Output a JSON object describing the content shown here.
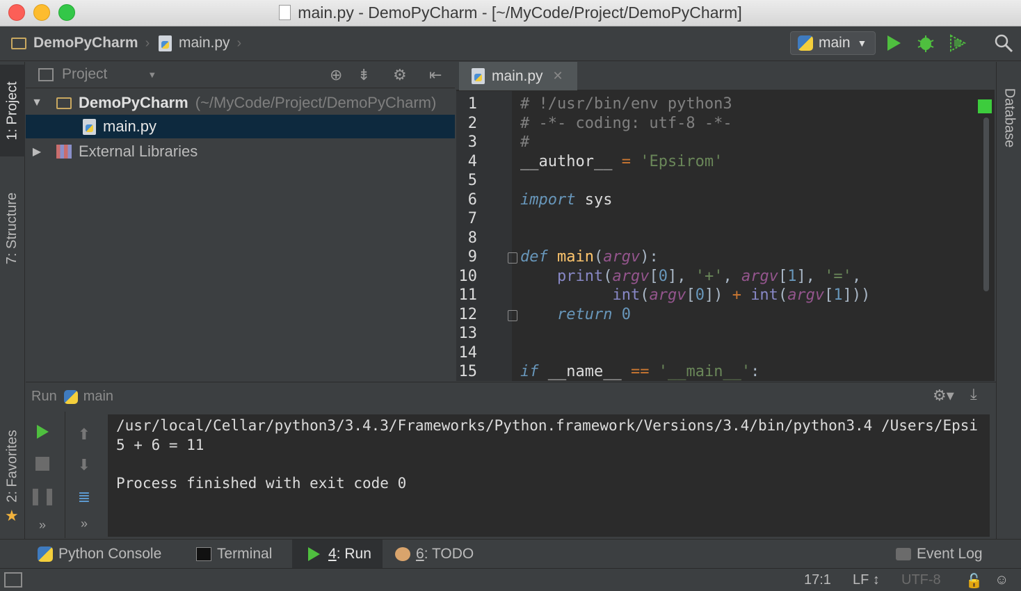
{
  "window": {
    "title": "main.py - DemoPyCharm - [~/MyCode/Project/DemoPyCharm]"
  },
  "navbar": {
    "crumbs": [
      "DemoPyCharm",
      "main.py"
    ],
    "run_config": "main"
  },
  "left_strip": {
    "tabs": [
      "1: Project",
      "7: Structure",
      "2: Favorites"
    ]
  },
  "right_strip": {
    "tabs": [
      "Database"
    ]
  },
  "project": {
    "header": "Project",
    "tree": [
      {
        "name": "DemoPyCharm",
        "path": "(~/MyCode/Project/DemoPyCharm)",
        "expanded": true
      },
      {
        "name": "main.py",
        "selected": true
      },
      {
        "name": "External Libraries",
        "expanded": false
      }
    ]
  },
  "editor": {
    "tab": "main.py",
    "line_numbers": [
      "1",
      "2",
      "3",
      "4",
      "5",
      "6",
      "7",
      "8",
      "9",
      "10",
      "11",
      "12",
      "13",
      "14",
      "15"
    ],
    "lines": [
      "# !/usr/bin/env python3",
      "# -*- coding: utf-8 -*-",
      "#",
      "__author__ = 'Epsirom'",
      "",
      "import sys",
      "",
      "",
      "def main(argv):",
      "    print(argv[0], '+', argv[1], '=',",
      "          int(argv[0]) + int(argv[1]))",
      "    return 0",
      "",
      "",
      "if __name__ == '__main__':"
    ]
  },
  "run": {
    "header_label": "Run",
    "config": "main",
    "console": [
      "/usr/local/Cellar/python3/3.4.3/Frameworks/Python.framework/Versions/3.4/bin/python3.4 /Users/Epsi",
      "5 + 6 = 11",
      "",
      "Process finished with exit code 0"
    ]
  },
  "bottom_tabs": {
    "python_console": "Python Console",
    "terminal": "Terminal",
    "run_num": "4",
    "run_label": ": Run",
    "todo_num": "6",
    "todo_label": ": TODO",
    "event_log": "Event Log"
  },
  "status": {
    "position": "17:1",
    "line_sep": "LF ↕",
    "encoding": "UTF-8"
  },
  "colors": {
    "run_green": "#499c54",
    "background": "#3c3f41",
    "editor_bg": "#2b2b2b"
  }
}
